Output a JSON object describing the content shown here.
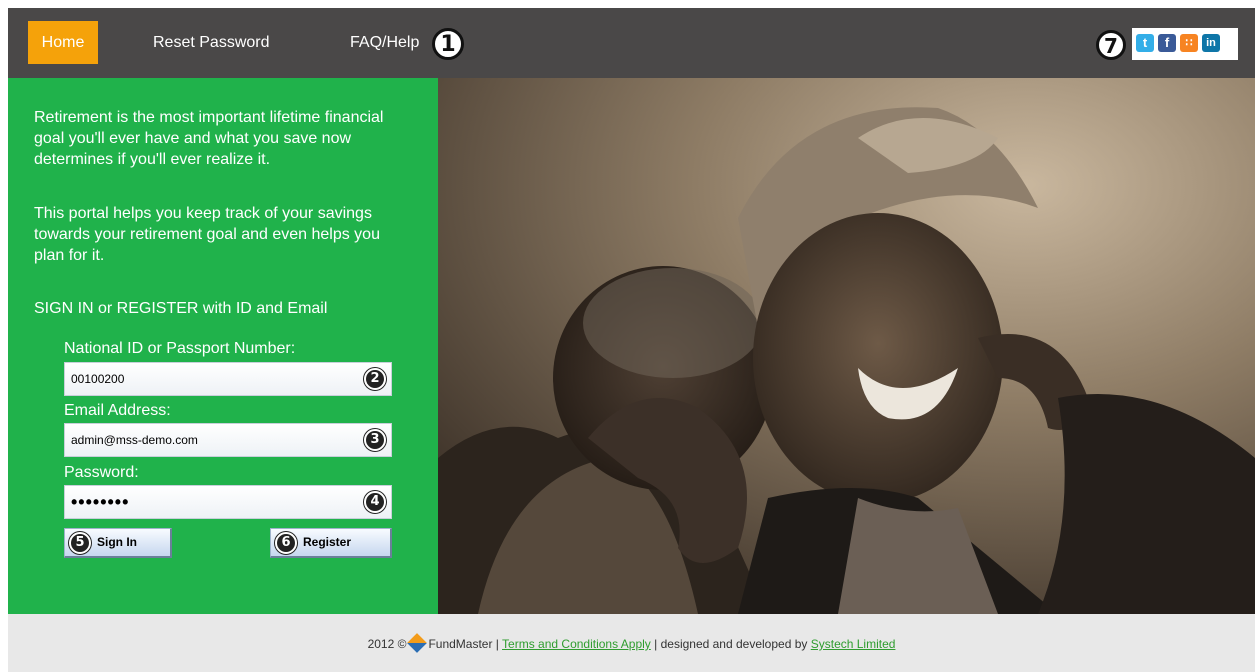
{
  "nav": {
    "home": "Home",
    "reset_password": "Reset Password",
    "faq": "FAQ/Help"
  },
  "markers": {
    "m1": "1",
    "m2": "2",
    "m3": "3",
    "m4": "4",
    "m5": "5",
    "m6": "6",
    "m7": "7"
  },
  "social": {
    "icons": [
      "twitter-icon",
      "facebook-icon",
      "rss-icon",
      "linkedin-icon"
    ],
    "twitter": "t",
    "facebook": "f",
    "rss": "∷",
    "linkedin": "in"
  },
  "intro": {
    "paragraph1": "Retirement is the most important lifetime financial goal you'll ever have and what you save now determines if you'll ever realize it.",
    "paragraph2": "This portal helps you keep track of your savings towards your retirement goal and even helps you plan for it.",
    "signin_heading": "SIGN IN or REGISTER with ID and Email"
  },
  "form": {
    "id_label": "National ID or Passport Number:",
    "id_value": "00100200",
    "email_label": "Email Address:",
    "email_value": "admin@mss-demo.com",
    "password_label": "Password:",
    "password_value": "••••••••",
    "signin_button": "Sign In",
    "register_button": "Register"
  },
  "footer": {
    "prefix": "2012 ©",
    "brand": "FundMaster |",
    "terms_link": "Terms and Conditions Apply",
    "middle": "| designed and developed by",
    "dev_link": "Systech Limited"
  },
  "colors": {
    "topbar": "#4a4848",
    "home_tab": "#f5a20a",
    "panel_green": "#20b24b",
    "footer_bg": "#e8e8e8",
    "link_green": "#2f9d2f"
  }
}
